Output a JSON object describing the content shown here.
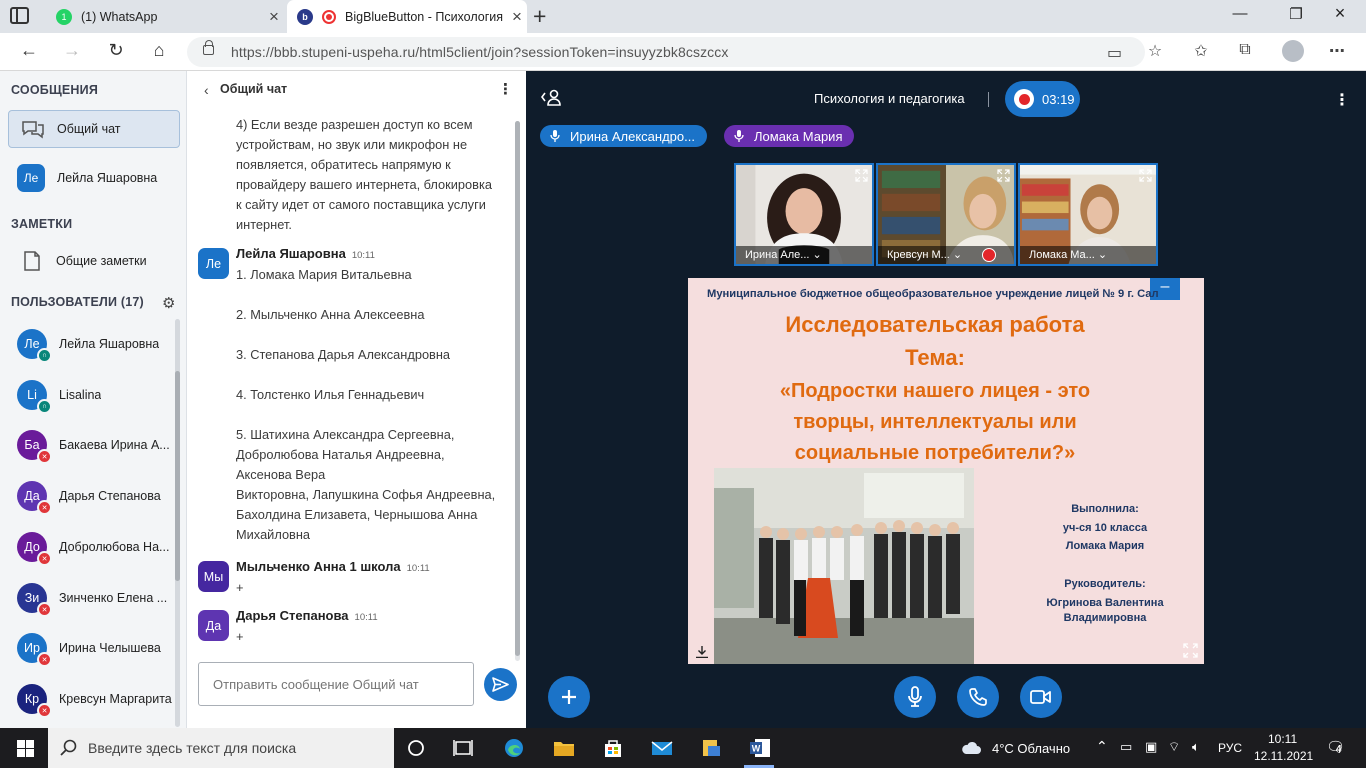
{
  "browser": {
    "tabs": [
      {
        "title": "(1) WhatsApp",
        "icon": "whatsapp-icon",
        "badge": "1"
      },
      {
        "title": "BigBlueButton - Психология",
        "icon": "bigbluebutton-icon",
        "badge": "b"
      }
    ],
    "url": "https://bbb.stupeni-uspeha.ru/html5client/join?sessionToken=insuyyzbk8cszccx"
  },
  "sidebar": {
    "messages_heading": "СООБЩЕНИЯ",
    "chats": [
      {
        "label": "Общий чат",
        "icon": "chat-bubbles-icon"
      },
      {
        "initials": "Ле",
        "label": "Лейла Яшаровна"
      }
    ],
    "notes_heading": "ЗАМЕТКИ",
    "notes": [
      {
        "label": "Общие заметки",
        "icon": "notes-icon"
      }
    ],
    "users_heading": "ПОЛЬЗОВАТЕЛИ (17)",
    "users": [
      {
        "initials": "Ле",
        "name": "Лейла Яшаровна",
        "color": "#1b73c8",
        "status": "headset"
      },
      {
        "initials": "Li",
        "name": "Lisalina",
        "color": "#1b73c8",
        "status": "headset"
      },
      {
        "initials": "Ба",
        "name": "Бакаева Ирина А...",
        "color": "#6a1b9a",
        "status": "muted"
      },
      {
        "initials": "Да",
        "name": "Дарья Степанова",
        "color": "#5e35b1",
        "status": "muted"
      },
      {
        "initials": "До",
        "name": "Добролюбова На...",
        "color": "#6a1b9a",
        "status": "muted"
      },
      {
        "initials": "Зи",
        "name": "Зинченко Елена ...",
        "color": "#283593",
        "status": "muted"
      },
      {
        "initials": "Ир",
        "name": "Ирина Челышева",
        "color": "#1b73c8",
        "status": "muted"
      },
      {
        "initials": "Кр",
        "name": "Кревсун Маргарита",
        "color": "#1a237e",
        "status": "muted"
      }
    ]
  },
  "chat": {
    "title": "Общий чат",
    "intro_lines": [
      "4) Если везде разрешен доступ ко всем",
      "устройствам, но звук или микрофон не",
      "появляется, обратитесь напрямую к",
      "провайдеру вашего интернета, блокировка",
      "к сайту идет от самого поставщика услуги",
      "интернет."
    ],
    "messages": [
      {
        "initials": "Ле",
        "color": "#1b73c8",
        "author": "Лейла Яшаровна",
        "time": "10:11",
        "lines": [
          "1. Ломака Мария Витальевна",
          "",
          "2. Мыльченко Анна Алексеевна",
          "",
          "3. Степанова Дарья Александровна",
          "",
          "4. Толстенко Илья Геннадьевич",
          "",
          "5. Шатихина Александра Сергеевна,",
          "Добролюбова Наталья Андреевна,",
          "Аксенова Вера",
          "Викторовна, Лапушкина Софья Андреевна,",
          "Бахолдина Елизавета, Чернышова Анна",
          "Михайловна"
        ]
      },
      {
        "initials": "Мы",
        "color": "#4527a0",
        "author": "Мыльченко Анна 1 школа",
        "time": "10:11",
        "lines": [
          "+"
        ]
      },
      {
        "initials": "Да",
        "color": "#5e35b1",
        "author": "Дарья Степанова",
        "time": "10:11",
        "lines": [
          "+"
        ]
      }
    ],
    "input_placeholder": "Отправить сообщение Общий чат"
  },
  "meeting": {
    "title": "Психология и педагогика",
    "recording_time": "03:19",
    "talkers": [
      {
        "name": "Ирина Александро...",
        "color": "#1b73c8"
      },
      {
        "name": "Ломака Мария",
        "color": "#6a2fb0"
      }
    ],
    "webcams": [
      {
        "label": "Ирина Але...",
        "muted": false
      },
      {
        "label": "Кревсун М...",
        "muted": true
      },
      {
        "label": "Ломака Ма...",
        "muted": false
      }
    ],
    "slide": {
      "institution": "Муниципальное бюджетное общеобразовательное учреждение лицей № 9 г. Сал",
      "title_line1": "Исследовательская работа",
      "title_line2": "Тема:",
      "topic_lines": [
        "«Подростки нашего лицея - это",
        "творцы, интеллектуалы или",
        "социальные потребители?»"
      ],
      "author_heading": "Выполнила:",
      "author_line1": "уч-ся 10 класса",
      "author_line2": "Ломака Мария",
      "supervisor_heading": "Руководитель:",
      "supervisor_line1": "Югринова Валентина",
      "supervisor_line2": "Владимировна"
    }
  },
  "taskbar": {
    "search_placeholder": "Введите здесь текст для поиска",
    "weather": "4°C  Облачно",
    "language": "РУС",
    "time": "10:11",
    "date": "12.11.2021",
    "notifications": "4"
  }
}
